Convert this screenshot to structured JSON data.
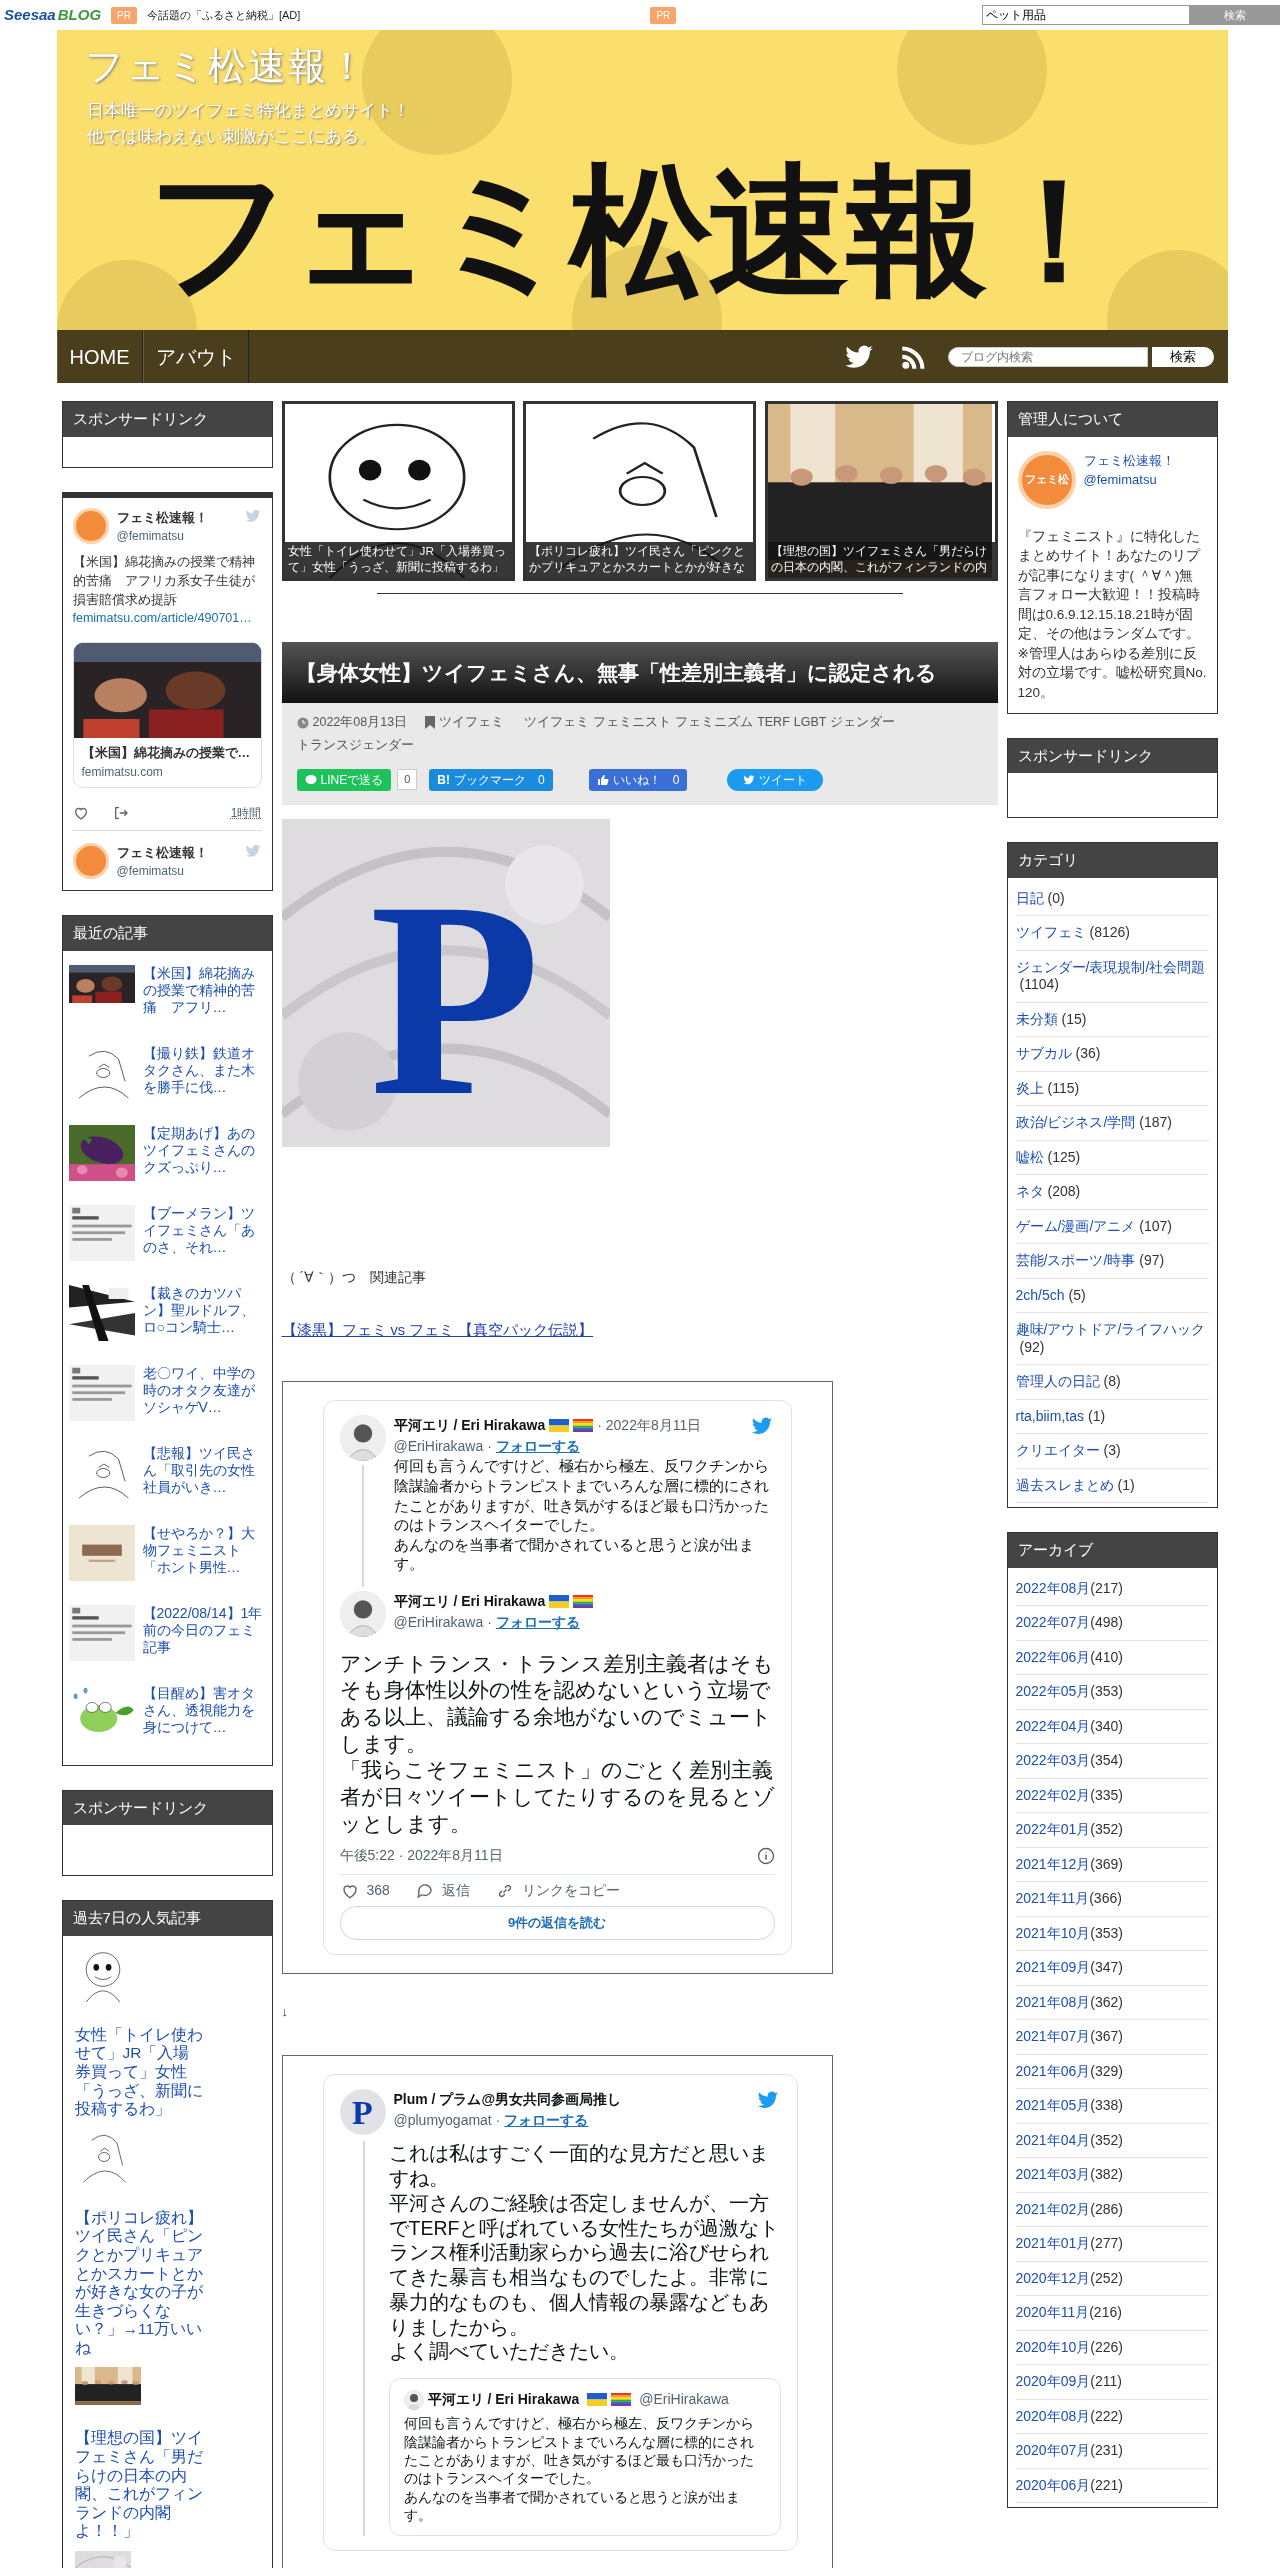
{
  "topbar": {
    "logo": "Seesaa",
    "logo_sub": "BLOG",
    "pr": [
      {
        "badge": "PR",
        "text": "今話題の「ふるさと納税」[AD]"
      },
      {
        "badge": "PR"
      }
    ],
    "search": {
      "value": "ペット用品",
      "button": "検索"
    }
  },
  "header": {
    "title": "フェミ松速報！",
    "tagline": [
      "日本唯一のツイフェミ特化まとめサイト！",
      "他では味わえない刺激がここにある。"
    ],
    "logo_text": "フェミ松速報！"
  },
  "nav": {
    "items": [
      {
        "label": "HOME"
      },
      {
        "label": "アバウト"
      }
    ],
    "search": {
      "placeholder": "ブログ内検索",
      "button": "検索"
    }
  },
  "left": {
    "sponsor_title": "スポンサードリンク",
    "twitter": {
      "name": "フェミ松速報！",
      "handle": "@femimatsu",
      "text": "【米国】綿花摘みの授業で精神的苦痛　アフリカ系女子生徒が損害賠償求め提訴",
      "link": "femimatsu.com/article/490701…",
      "card_title": "【米国】綿花摘みの授業で…",
      "card_domain": "femimatsu.com",
      "time": "1時間",
      "next_name": "フェミ松速報！",
      "next_handle": "@femimatsu"
    },
    "recent": {
      "title": "最近の記事",
      "items": [
        {
          "text": "【米国】綿花摘みの授業で精神的苦痛　アフリ…"
        },
        {
          "text": "【撮り鉄】鉄道オタクさん、また木を勝手に伐…"
        },
        {
          "text": "【定期あげ】あのツイフェミさんのクズっぷり…"
        },
        {
          "text": "【ブーメラン】ツイフェミさん「あのさ、それ…"
        },
        {
          "text": "【裁きのカツパン】聖ルドルフ、ロ○コン騎士…"
        },
        {
          "text": "老〇ワイ、中学の時のオタク友達がソシャゲV…"
        },
        {
          "text": "【悲報】ツイ民さん「取引先の女性社員がいき…"
        },
        {
          "text": "【せやろか？】大物フェミニスト「ホント男性…"
        },
        {
          "text": "【2022/08/14】1年前の今日のフェミ記事"
        },
        {
          "text": "【目醒め】害オタさん、透視能力を身につけて…"
        }
      ]
    },
    "sponsor_title_2": "スポンサードリンク",
    "popular": {
      "title": "過去7日の人気記事",
      "items": [
        {
          "kind": "article",
          "text": "女性「トイレ使わせて」JR「入場券買って」女性「うっざ、新聞に投稿するわ」"
        },
        {
          "kind": "article",
          "text": "【ポリコレ疲れ】ツイ民さん「ピンクとかプリキュアとかスカートとかが好きな女の子が生きづらくない？」→11万いいね"
        },
        {
          "kind": "article",
          "text": "【理想の国】ツイフェミさん「男だらけの日本の内閣、これがフィンランドの内閣よ！！」"
        },
        {
          "kind": "picture"
        }
      ]
    }
  },
  "slider": [
    {
      "caption": "女性「トイレ使わせて」JR「入場券買って」女性「うっざ、新聞に投稿するわ」"
    },
    {
      "caption": "【ポリコレ疲れ】ツイ民さん「ピンクとかプリキュアとかスカートとかが好きな"
    },
    {
      "caption": "【理想の国】ツイフェミさん「男だらけの日本の内閣、これがフィンランドの内"
    }
  ],
  "article": {
    "title": "【身体女性】ツイフェミさん、無事「性差別主義者」に認定される",
    "date": "2022年08月13日",
    "category": "ツイフェミ",
    "tags": [
      "ツイフェミ",
      "フェミニスト",
      "フェミニズム",
      "TERF",
      "LGBT",
      "ジェンダー",
      "トランスジェンダー"
    ],
    "share": {
      "line": "LINEで送る",
      "line_count": "0",
      "hatena_mark": "B!",
      "hatena": "ブックマーク",
      "hatena_count": "0",
      "fb": "いいね！",
      "fb_count": "0",
      "tweet": "ツイート"
    },
    "image_letter": "P",
    "related_label": "（ ´∀｀）つ　関連記事",
    "related_link": "【漆黒】フェミ vs フェミ 【真空パック伝説】",
    "arrow": "↓",
    "tweet1": {
      "parent": {
        "name": "平河エリ / Eri Hirakawa",
        "handle": "@EriHirakawa",
        "separator": "·",
        "follow": "フォローする",
        "date": "· 2022年8月11日",
        "text": [
          "何回も言うんですけど、極右から極左、反ワクチンから陰謀論者からトランピストまでいろんな層に標的にされたことがありますが、吐き気がするほど最も口汚かったのはトランスヘイターでした。",
          "あんなのを当事者で聞かされていると思うと涙が出ます。"
        ]
      },
      "main": {
        "name": "平河エリ / Eri Hirakawa",
        "handle": "@EriHirakawa",
        "separator": "·",
        "follow": "フォローする",
        "text": [
          "アンチトランス・トランス差別主義者はそもそも身体性以外の性を認めないという立場である以上、議論する余地がないのでミュートします。",
          "「我らこそフェミニスト」のごとく差別主義者が日々ツイートしてたりするのを見るとゾッとします。"
        ],
        "time": "午後5:22 · 2022年8月11日",
        "likes": "368",
        "reply": "返信",
        "copy": "リンクをコピー",
        "read": "9件の返信を読む"
      }
    },
    "tweet2": {
      "avatar_letter": "P",
      "name": "Plum / プラム@男女共同参画局推し",
      "handle": "@plumyogamat",
      "separator": "·",
      "follow": "フォローする",
      "text": [
        "これは私はすごく一面的な見方だと思いますね。",
        "平河さんのご経験は否定しませんが、一方でTERFと呼ばれている女性たちが過激なトランス権利活動家らから過去に浴びせられてきた暴言も相当なものでしたよ。非常に暴力的なものも、個人情報の暴露などもありましたから。",
        "よく調べていただきたい。"
      ],
      "quote": {
        "name": "平河エリ / Eri Hirakawa",
        "handle": "@EriHirakawa",
        "text": [
          "何回も言うんですけど、極右から極左、反ワクチンから陰謀論者からトランピストまでいろんな層に標的にされたことがありますが、吐き気がするほど最も口汚かったのはトランスヘイターでした。",
          "あんなのを当事者で聞かされていると思うと涙が出ます。"
        ]
      }
    }
  },
  "right": {
    "admin": {
      "title": "管理人について",
      "avatar_label": "フェミ松",
      "name": "フェミ松速報！",
      "handle": "@femimatsu",
      "text": "『フェミニスト』に特化したまとめサイト！あなたのリプが記事になります( ＾∀＾)無言フォロー大歓迎！！投稿時間は0.6.9.12.15.18.21時が固定、その他はランダムです。※管理人はあらゆる差別に反対の立場です。嘘松研究員No.120。"
    },
    "sponsor_title": "スポンサードリンク",
    "categories": {
      "title": "カテゴリ",
      "items": [
        {
          "label": "日記",
          "count": "(0)"
        },
        {
          "label": "ツイフェミ",
          "count": "(8126)"
        },
        {
          "label": "ジェンダー/表現規制/社会問題",
          "count": "(1104)"
        },
        {
          "label": "未分類",
          "count": "(15)"
        },
        {
          "label": "サブカル",
          "count": "(36)"
        },
        {
          "label": "炎上",
          "count": "(115)"
        },
        {
          "label": "政治/ビジネス/学問",
          "count": "(187)"
        },
        {
          "label": "嘘松",
          "count": "(125)"
        },
        {
          "label": "ネタ",
          "count": "(208)"
        },
        {
          "label": "ゲーム/漫画/アニメ",
          "count": "(107)"
        },
        {
          "label": "芸能/スポーツ/時事",
          "count": "(97)"
        },
        {
          "label": "2ch/5ch",
          "count": "(5)"
        },
        {
          "label": "趣味/アウトドア/ライフハック",
          "count": "(92)"
        },
        {
          "label": "管理人の日記",
          "count": "(8)"
        },
        {
          "label": "rta,biim,tas",
          "count": "(1)"
        },
        {
          "label": "クリエイター",
          "count": "(3)"
        },
        {
          "label": "過去スレまとめ",
          "count": "(1)"
        }
      ]
    },
    "archive": {
      "title": "アーカイブ",
      "items": [
        {
          "label": "2022年08月",
          "count": "(217)"
        },
        {
          "label": "2022年07月",
          "count": "(498)"
        },
        {
          "label": "2022年06月",
          "count": "(410)"
        },
        {
          "label": "2022年05月",
          "count": "(353)"
        },
        {
          "label": "2022年04月",
          "count": "(340)"
        },
        {
          "label": "2022年03月",
          "count": "(354)"
        },
        {
          "label": "2022年02月",
          "count": "(335)"
        },
        {
          "label": "2022年01月",
          "count": "(352)"
        },
        {
          "label": "2021年12月",
          "count": "(369)"
        },
        {
          "label": "2021年11月",
          "count": "(366)"
        },
        {
          "label": "2021年10月",
          "count": "(353)"
        },
        {
          "label": "2021年09月",
          "count": "(347)"
        },
        {
          "label": "2021年08月",
          "count": "(362)"
        },
        {
          "label": "2021年07月",
          "count": "(367)"
        },
        {
          "label": "2021年06月",
          "count": "(329)"
        },
        {
          "label": "2021年05月",
          "count": "(338)"
        },
        {
          "label": "2021年04月",
          "count": "(352)"
        },
        {
          "label": "2021年03月",
          "count": "(382)"
        },
        {
          "label": "2021年02月",
          "count": "(286)"
        },
        {
          "label": "2021年01月",
          "count": "(277)"
        },
        {
          "label": "2020年12月",
          "count": "(252)"
        },
        {
          "label": "2020年11月",
          "count": "(216)"
        },
        {
          "label": "2020年10月",
          "count": "(226)"
        },
        {
          "label": "2020年09月",
          "count": "(211)"
        },
        {
          "label": "2020年08月",
          "count": "(222)"
        },
        {
          "label": "2020年07月",
          "count": "(231)"
        },
        {
          "label": "2020年06月",
          "count": "(221)"
        }
      ]
    }
  }
}
